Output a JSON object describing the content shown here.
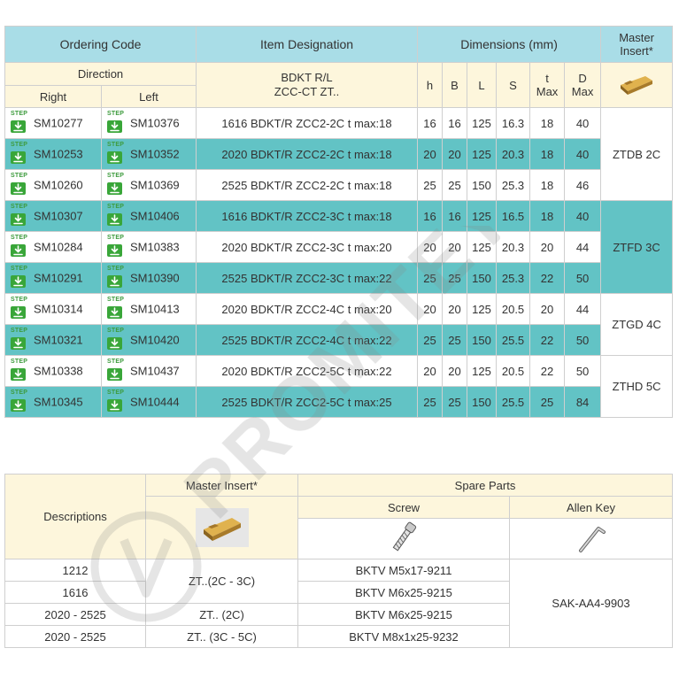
{
  "table1": {
    "header": {
      "ordering_code": "Ordering Code",
      "item_designation": "Item Designation",
      "dimensions": "Dimensions (mm)",
      "master_insert_line1": "Master",
      "master_insert_line2": "Insert*",
      "direction": "Direction",
      "designation_line1": "BDKT R/L",
      "designation_line2": "ZCC-CT ZT..",
      "right": "Right",
      "left": "Left",
      "h": "h",
      "B": "B",
      "L": "L",
      "S": "S",
      "t_line1": "t",
      "t_line2": "Max",
      "D_line1": "D",
      "D_line2": "Max"
    },
    "step_label": "STEP",
    "rows": [
      {
        "right": "SM10277",
        "left": "SM10376",
        "designation": "1616 BDKT/R ZCC2-2C t max:18",
        "h": "16",
        "B": "16",
        "L": "125",
        "S": "16.3",
        "t": "18",
        "D": "40"
      },
      {
        "right": "SM10253",
        "left": "SM10352",
        "designation": "2020 BDKT/R ZCC2-2C t max:18",
        "h": "20",
        "B": "20",
        "L": "125",
        "S": "20.3",
        "t": "18",
        "D": "40"
      },
      {
        "right": "SM10260",
        "left": "SM10369",
        "designation": "2525 BDKT/R ZCC2-2C t max:18",
        "h": "25",
        "B": "25",
        "L": "150",
        "S": "25.3",
        "t": "18",
        "D": "46"
      },
      {
        "right": "SM10307",
        "left": "SM10406",
        "designation": "1616 BDKT/R ZCC2-3C t max:18",
        "h": "16",
        "B": "16",
        "L": "125",
        "S": "16.5",
        "t": "18",
        "D": "40"
      },
      {
        "right": "SM10284",
        "left": "SM10383",
        "designation": "2020 BDKT/R ZCC2-3C t max:20",
        "h": "20",
        "B": "20",
        "L": "125",
        "S": "20.3",
        "t": "20",
        "D": "44"
      },
      {
        "right": "SM10291",
        "left": "SM10390",
        "designation": "2525 BDKT/R ZCC2-3C t max:22",
        "h": "25",
        "B": "25",
        "L": "150",
        "S": "25.3",
        "t": "22",
        "D": "50"
      },
      {
        "right": "SM10314",
        "left": "SM10413",
        "designation": "2020 BDKT/R ZCC2-4C t max:20",
        "h": "20",
        "B": "20",
        "L": "125",
        "S": "20.5",
        "t": "20",
        "D": "44"
      },
      {
        "right": "SM10321",
        "left": "SM10420",
        "designation": "2525 BDKT/R ZCC2-4C t max:22",
        "h": "25",
        "B": "25",
        "L": "150",
        "S": "25.5",
        "t": "22",
        "D": "50"
      },
      {
        "right": "SM10338",
        "left": "SM10437",
        "designation": "2020 BDKT/R ZCC2-5C t max:22",
        "h": "20",
        "B": "20",
        "L": "125",
        "S": "20.5",
        "t": "22",
        "D": "50"
      },
      {
        "right": "SM10345",
        "left": "SM10444",
        "designation": "2525 BDKT/R ZCC2-5C t max:25",
        "h": "25",
        "B": "25",
        "L": "150",
        "S": "25.5",
        "t": "25",
        "D": "84"
      }
    ],
    "master_groups": [
      "ZTDB 2C",
      "ZTFD 3C",
      "ZTGD 4C",
      "ZTHD 5C"
    ]
  },
  "table2": {
    "descriptions": "Descriptions",
    "master_insert": "Master Insert*",
    "spare_parts": "Spare Parts",
    "screw": "Screw",
    "allen_key": "Allen Key",
    "rows": [
      {
        "desc": "1212",
        "screw": "BKTV M5x17-9211"
      },
      {
        "desc": "1616",
        "screw": "BKTV M6x25-9215"
      },
      {
        "desc": "2020 - 2525",
        "screw": "BKTV M6x25-9215"
      },
      {
        "desc": "2020 - 2525",
        "screw": "BKTV M8x1x25-9232"
      }
    ],
    "insert_groups": [
      "ZT..(2C - 3C)",
      "ZT.. (2C)",
      "ZT.. (3C - 5C)"
    ],
    "allen_key_code": "SAK-AA4-9903"
  },
  "watermark": "PROMITEY",
  "colors": {
    "header_blue": "#a9dde7",
    "header_cream": "#fdf6dc",
    "row_teal": "#62c3c5",
    "step_green": "#39a639"
  }
}
